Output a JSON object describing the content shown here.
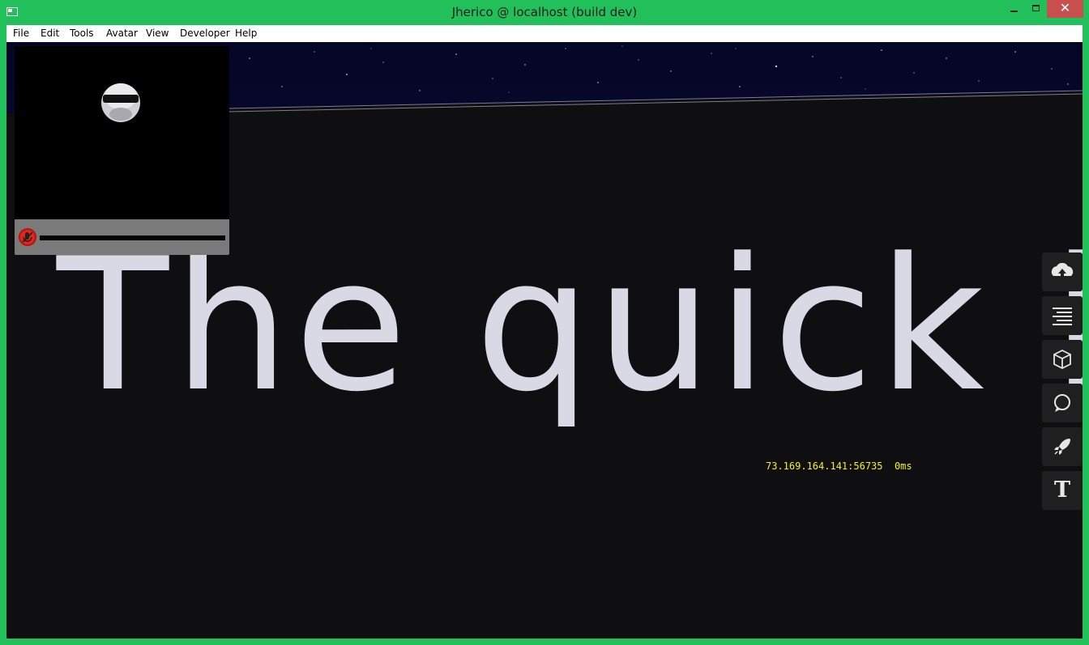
{
  "window": {
    "title": "Jherico @ localhost (build dev)",
    "close_glyph": "✕"
  },
  "menu": {
    "items": [
      "File",
      "Edit",
      "Tools",
      "Avatar",
      "View",
      "Developer",
      "Help"
    ]
  },
  "scene": {
    "text": "The quick br",
    "network_stats": "73.169.164.141:56735  0ms"
  },
  "mirror": {
    "audio_icon": "muted-mic-icon",
    "avatar_icon": "avatar-head-icon"
  },
  "toolbar": {
    "tools": [
      "marketplace-icon",
      "directory-icon",
      "edit-entities-icon",
      "chat-bubble-icon",
      "examples-rocket-icon",
      "text-tool-icon"
    ],
    "text_tool_label": "T"
  },
  "colors": {
    "frame": "#21c05a",
    "close_button": "#c7504f",
    "stats_text": "#f5f019",
    "sky": "#050627"
  }
}
